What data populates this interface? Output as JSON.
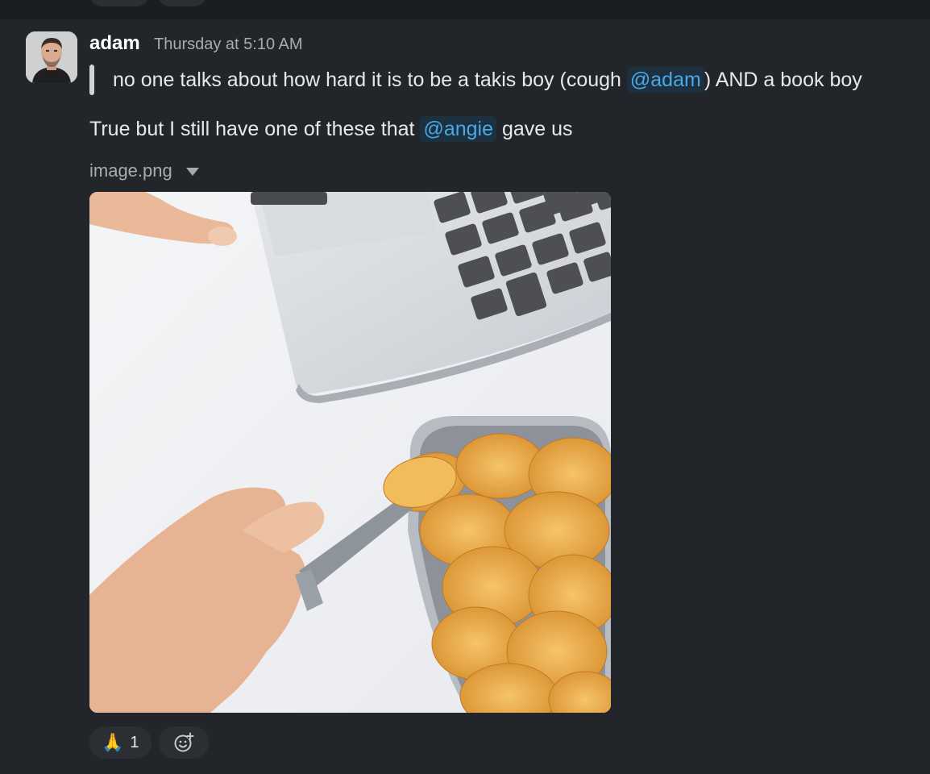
{
  "message": {
    "sender": "adam",
    "timestamp": "Thursday at 5:10 AM",
    "quote": {
      "before": "no one talks about how hard it is to be a takis boy (cough ",
      "mention": "@adam",
      "after": ") AND a book boy"
    },
    "body": {
      "before": "True but I still have one of these that ",
      "mention": "@angie",
      "after": " gave us"
    },
    "attachment": {
      "filename": "image.png"
    },
    "reactions": [
      {
        "icon": "folded-hands-emoji",
        "emoji": "🙏",
        "count": "1"
      }
    ],
    "add_reaction_icon": "add-reaction-icon"
  },
  "colors": {
    "background": "#222529",
    "mention": "#49a9e7",
    "mention_bg": "#1d3040",
    "timestamp": "#ababad"
  }
}
